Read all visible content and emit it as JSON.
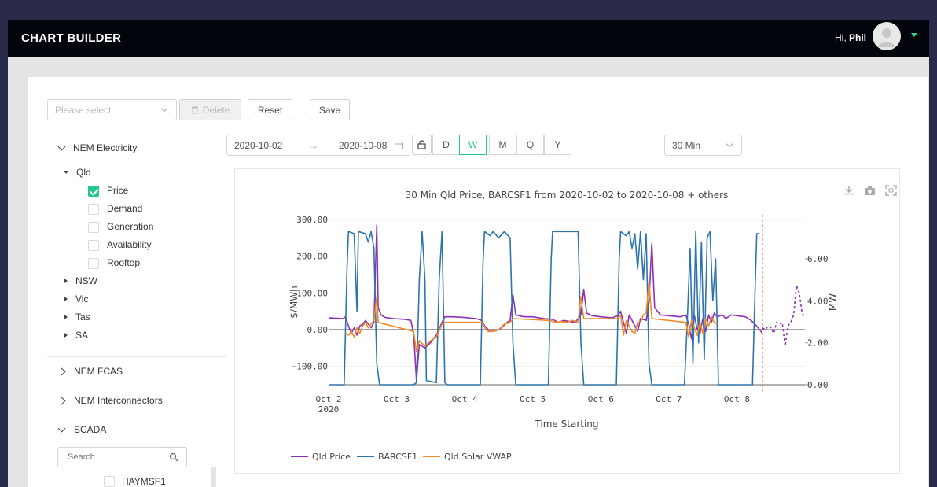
{
  "header": {
    "title": "CHART BUILDER",
    "greeting": "Hi,",
    "user": "Phil"
  },
  "toolbar": {
    "select_placeholder": "Please select",
    "delete_label": "Delete",
    "reset_label": "Reset",
    "save_label": "Save"
  },
  "range": {
    "start": "2020-10-02",
    "arrow": "→",
    "end": "2020-10-08"
  },
  "periods": [
    "D",
    "W",
    "M",
    "Q",
    "Y"
  ],
  "active_period": "W",
  "interval": "30 Min",
  "tree": {
    "nem_electricity": "NEM Electricity",
    "qld": "Qld",
    "qld_items": [
      "Price",
      "Demand",
      "Generation",
      "Availability",
      "Rooftop"
    ],
    "checked": "Price",
    "regions": [
      "NSW",
      "Vic",
      "Tas",
      "SA"
    ],
    "nem_fcas": "NEM FCAS",
    "nem_interconnectors": "NEM Interconnectors",
    "scada": "SCADA",
    "search_placeholder": "Search",
    "scada_item": "HAYMSF1"
  },
  "colors": {
    "accent": "#23c98a",
    "price": "#8e2fb5",
    "barcsf1": "#2d74ad",
    "solar": "#f08a24"
  },
  "chart_data": {
    "type": "line",
    "title": "30 Min Qld Price, BARCSF1 from 2020-10-02 to 2020-10-08 + others",
    "xlabel": "Time Starting",
    "ylabel": "$/MWh",
    "y2label": "MW",
    "x_ticks": [
      "Oct 2",
      "Oct 3",
      "Oct 4",
      "Oct 5",
      "Oct 6",
      "Oct 7",
      "Oct 8"
    ],
    "x_tick_year": "2020",
    "xlim": [
      "2020-10-02 00:00",
      "2020-10-09 00:00"
    ],
    "y_ticks": [
      "300.00",
      "200.00",
      "100.00",
      "0.00",
      "−100.00"
    ],
    "ylim": [
      -150,
      300
    ],
    "y2_ticks": [
      "6.00",
      "4.00",
      "2.00",
      "0.00"
    ],
    "y2lim": [
      0,
      7.5
    ],
    "cutoff": "2020-10-08 09:00",
    "series": [
      {
        "name": "Qld Price",
        "color": "#8e2fb5",
        "axis": "y",
        "points": [
          [
            "10-02 00:00",
            32
          ],
          [
            "10-02 03:00",
            31
          ],
          [
            "10-02 05:00",
            30
          ],
          [
            "10-02 06:00",
            35
          ],
          [
            "10-02 07:00",
            10
          ],
          [
            "10-02 08:00",
            -10
          ],
          [
            "10-02 09:00",
            5
          ],
          [
            "10-02 10:00",
            -15
          ],
          [
            "10-02 11:00",
            10
          ],
          [
            "10-02 12:00",
            15
          ],
          [
            "10-02 13:00",
            25
          ],
          [
            "10-02 15:00",
            5
          ],
          [
            "10-02 16:00",
            20
          ],
          [
            "10-02 17:00",
            285
          ],
          [
            "10-02 17:30",
            60
          ],
          [
            "10-02 18:30",
            40
          ],
          [
            "10-02 20:00",
            33
          ],
          [
            "10-02 23:00",
            30
          ],
          [
            "10-03 03:00",
            28
          ],
          [
            "10-03 05:00",
            25
          ],
          [
            "10-03 06:00",
            -10
          ],
          [
            "10-03 07:00",
            -140
          ],
          [
            "10-03 08:00",
            -40
          ],
          [
            "10-03 10:00",
            -50
          ],
          [
            "10-03 12:00",
            -35
          ],
          [
            "10-03 14:00",
            -15
          ],
          [
            "10-03 16:00",
            20
          ],
          [
            "10-03 17:00",
            35
          ],
          [
            "10-03 20:00",
            35
          ],
          [
            "10-04 00:00",
            33
          ],
          [
            "10-04 04:00",
            30
          ],
          [
            "10-04 06:00",
            25
          ],
          [
            "10-04 07:00",
            10
          ],
          [
            "10-04 09:00",
            -5
          ],
          [
            "10-04 11:00",
            -3
          ],
          [
            "10-04 13:00",
            5
          ],
          [
            "10-04 15:00",
            20
          ],
          [
            "10-04 16:00",
            25
          ],
          [
            "10-04 17:00",
            95
          ],
          [
            "10-04 18:00",
            40
          ],
          [
            "10-04 21:00",
            35
          ],
          [
            "10-05 00:00",
            35
          ],
          [
            "10-05 04:00",
            30
          ],
          [
            "10-05 07:00",
            28
          ],
          [
            "10-05 09:00",
            20
          ],
          [
            "10-05 11:00",
            25
          ],
          [
            "10-05 13:00",
            22
          ],
          [
            "10-05 15:00",
            20
          ],
          [
            "10-05 17:00",
            40
          ],
          [
            "10-05 18:00",
            110
          ],
          [
            "10-05 19:00",
            45
          ],
          [
            "10-05 21:00",
            38
          ],
          [
            "10-06 00:00",
            35
          ],
          [
            "10-06 04:00",
            32
          ],
          [
            "10-06 06:00",
            38
          ],
          [
            "10-06 07:00",
            50
          ],
          [
            "10-06 09:00",
            -10
          ],
          [
            "10-06 10:00",
            40
          ],
          [
            "10-06 11:00",
            25
          ],
          [
            "10-06 12:00",
            10
          ],
          [
            "10-06 13:00",
            -5
          ],
          [
            "10-06 14:00",
            30
          ],
          [
            "10-06 16:00",
            25
          ],
          [
            "10-06 17:00",
            75
          ],
          [
            "10-06 18:00",
            235
          ],
          [
            "10-06 19:00",
            60
          ],
          [
            "10-06 21:00",
            40
          ],
          [
            "10-07 00:00",
            38
          ],
          [
            "10-07 04:00",
            35
          ],
          [
            "10-07 06:00",
            40
          ],
          [
            "10-07 07:00",
            15
          ],
          [
            "10-07 08:00",
            -25
          ],
          [
            "10-07 09:00",
            40
          ],
          [
            "10-07 10:00",
            0
          ],
          [
            "10-07 11:00",
            -10
          ],
          [
            "10-07 12:00",
            30
          ],
          [
            "10-07 13:00",
            -5
          ],
          [
            "10-07 14:00",
            40
          ],
          [
            "10-07 15:00",
            20
          ],
          [
            "10-07 16:00",
            45
          ],
          [
            "10-07 17:00",
            35
          ],
          [
            "10-07 19:00",
            40
          ],
          [
            "10-07 20:00",
            30
          ],
          [
            "10-07 22:00",
            40
          ],
          [
            "10-08 00:00",
            38
          ],
          [
            "10-08 03:00",
            35
          ],
          [
            "10-08 05:00",
            25
          ],
          [
            "10-08 07:00",
            10
          ],
          [
            "10-08 09:00",
            -10
          ]
        ]
      },
      {
        "name": "BARCSF1",
        "color": "#2d74ad",
        "axis": "y2",
        "points": [
          [
            "10-02 00:00",
            0
          ],
          [
            "10-02 05:30",
            0
          ],
          [
            "10-02 06:30",
            5.5
          ],
          [
            "10-02 07:00",
            7.3
          ],
          [
            "10-02 09:00",
            7.2
          ],
          [
            "10-02 10:00",
            3.5
          ],
          [
            "10-02 10:30",
            7.3
          ],
          [
            "10-02 13:00",
            7.2
          ],
          [
            "10-02 14:00",
            6.8
          ],
          [
            "10-02 15:00",
            7.3
          ],
          [
            "10-02 16:00",
            6.5
          ],
          [
            "10-02 17:00",
            1
          ],
          [
            "10-02 18:00",
            0
          ],
          [
            "10-03 05:00",
            0
          ],
          [
            "10-03 06:00",
            0
          ],
          [
            "10-03 07:00",
            0.1
          ],
          [
            "10-03 08:00",
            5
          ],
          [
            "10-03 09:00",
            7.3
          ],
          [
            "10-03 10:00",
            5
          ],
          [
            "10-03 10:30",
            0.2
          ],
          [
            "10-03 14:00",
            0.1
          ],
          [
            "10-03 15:00",
            5
          ],
          [
            "10-03 16:00",
            7.3
          ],
          [
            "10-03 17:00",
            0.1
          ],
          [
            "10-03 18:00",
            0
          ],
          [
            "10-04 05:30",
            0
          ],
          [
            "10-04 06:30",
            6
          ],
          [
            "10-04 07:00",
            7.3
          ],
          [
            "10-04 09:00",
            7.1
          ],
          [
            "10-04 10:00",
            7.3
          ],
          [
            "10-04 12:00",
            7.0
          ],
          [
            "10-04 14:00",
            7.3
          ],
          [
            "10-04 16:00",
            7
          ],
          [
            "10-04 17:00",
            2
          ],
          [
            "10-04 18:00",
            0
          ],
          [
            "10-05 05:30",
            0
          ],
          [
            "10-05 06:30",
            6
          ],
          [
            "10-05 07:00",
            7.3
          ],
          [
            "10-05 16:00",
            7.3
          ],
          [
            "10-05 17:00",
            2
          ],
          [
            "10-05 18:00",
            0
          ],
          [
            "10-06 05:30",
            0
          ],
          [
            "10-06 06:30",
            6
          ],
          [
            "10-06 07:00",
            7.3
          ],
          [
            "10-06 09:00",
            7.1
          ],
          [
            "10-06 10:00",
            7.3
          ],
          [
            "10-06 11:00",
            6.5
          ],
          [
            "10-06 12:00",
            7.2
          ],
          [
            "10-06 13:00",
            5.5
          ],
          [
            "10-06 14:00",
            7.3
          ],
          [
            "10-06 15:00",
            5
          ],
          [
            "10-06 16:00",
            7.2
          ],
          [
            "10-06 17:00",
            1
          ],
          [
            "10-06 18:00",
            0
          ],
          [
            "10-07 05:30",
            0
          ],
          [
            "10-07 06:30",
            3
          ],
          [
            "10-07 07:30",
            6.5
          ],
          [
            "10-07 08:30",
            1
          ],
          [
            "10-07 09:30",
            7.3
          ],
          [
            "10-07 10:30",
            2
          ],
          [
            "10-07 11:30",
            6.8
          ],
          [
            "10-07 12:30",
            1.2
          ],
          [
            "10-07 13:30",
            7
          ],
          [
            "10-07 14:30",
            7.3
          ],
          [
            "10-07 15:30",
            4
          ],
          [
            "10-07 16:30",
            6
          ],
          [
            "10-07 17:30",
            0
          ],
          [
            "10-08 05:30",
            0
          ],
          [
            "10-08 06:30",
            5
          ],
          [
            "10-08 07:00",
            7.2
          ],
          [
            "10-08 08:00",
            7.2
          ]
        ]
      },
      {
        "name": "Qld Solar VWAP",
        "color": "#f08a24",
        "axis": "y",
        "points": [
          [
            "10-02 06:00",
            -10
          ],
          [
            "10-02 07:00",
            -15
          ],
          [
            "10-02 08:00",
            -5
          ],
          [
            "10-02 09:00",
            -20
          ],
          [
            "10-02 10:00",
            5
          ],
          [
            "10-02 11:00",
            -10
          ],
          [
            "10-02 12:00",
            10
          ],
          [
            "10-02 13:00",
            20
          ],
          [
            "10-02 14:00",
            5
          ],
          [
            "10-02 15:00",
            15
          ],
          [
            "10-02 16:00",
            25
          ],
          [
            "10-02 17:00",
            90
          ],
          [
            "10-02 17:30",
            20
          ],
          [
            "10-03 06:00",
            -5
          ],
          [
            "10-03 07:00",
            -60
          ],
          [
            "10-03 08:00",
            -30
          ],
          [
            "10-03 10:00",
            -45
          ],
          [
            "10-03 12:00",
            -30
          ],
          [
            "10-03 14:00",
            -20
          ],
          [
            "10-03 16:00",
            15
          ],
          [
            "10-03 17:00",
            20
          ],
          [
            "10-04 06:00",
            20
          ],
          [
            "10-04 08:00",
            -5
          ],
          [
            "10-04 10:00",
            -5
          ],
          [
            "10-04 12:00",
            0
          ],
          [
            "10-04 14:00",
            15
          ],
          [
            "10-04 16:00",
            20
          ],
          [
            "10-04 17:00",
            30
          ],
          [
            "10-05 06:00",
            25
          ],
          [
            "10-05 08:00",
            20
          ],
          [
            "10-05 10:00",
            22
          ],
          [
            "10-05 12:00",
            20
          ],
          [
            "10-05 14:00",
            25
          ],
          [
            "10-05 16:00",
            20
          ],
          [
            "10-05 17:00",
            90
          ],
          [
            "10-05 18:00",
            30
          ],
          [
            "10-06 06:00",
            30
          ],
          [
            "10-06 07:00",
            40
          ],
          [
            "10-06 08:00",
            -15
          ],
          [
            "10-06 09:00",
            25
          ],
          [
            "10-06 10:00",
            10
          ],
          [
            "10-06 11:00",
            -5
          ],
          [
            "10-06 12:00",
            -10
          ],
          [
            "10-06 13:00",
            20
          ],
          [
            "10-06 14:00",
            20
          ],
          [
            "10-06 15:00",
            40
          ],
          [
            "10-06 16:00",
            45
          ],
          [
            "10-06 17:00",
            130
          ],
          [
            "10-06 18:00",
            30
          ],
          [
            "10-07 06:00",
            20
          ],
          [
            "10-07 07:00",
            -20
          ],
          [
            "10-07 08:00",
            25
          ],
          [
            "10-07 09:00",
            5
          ],
          [
            "10-07 10:00",
            -15
          ],
          [
            "10-07 11:00",
            20
          ],
          [
            "10-07 12:00",
            -10
          ],
          [
            "10-07 13:00",
            30
          ],
          [
            "10-07 14:00",
            10
          ],
          [
            "10-07 15:00",
            35
          ],
          [
            "10-07 16:00",
            20
          ],
          [
            "10-07 17:00",
            15
          ]
        ]
      },
      {
        "name": "Qld Price forecast",
        "color": "#8e2fb5",
        "axis": "y",
        "dashed": true,
        "points": [
          [
            "10-08 09:00",
            5
          ],
          [
            "10-08 10:00",
            0
          ],
          [
            "10-08 11:00",
            10
          ],
          [
            "10-08 12:00",
            5
          ],
          [
            "10-08 13:00",
            -10
          ],
          [
            "10-08 14:00",
            20
          ],
          [
            "10-08 15:00",
            15
          ],
          [
            "10-08 16:00",
            20
          ],
          [
            "10-08 17:00",
            -45
          ],
          [
            "10-08 18:00",
            10
          ],
          [
            "10-08 19:00",
            20
          ],
          [
            "10-08 20:00",
            40
          ],
          [
            "10-08 21:00",
            120
          ],
          [
            "10-08 22:00",
            100
          ],
          [
            "10-08 23:00",
            45
          ],
          [
            "10-09 00:00",
            35
          ]
        ]
      }
    ],
    "legend": [
      "Qld Price",
      "BARCSF1",
      "Qld Solar VWAP"
    ],
    "legend_position": "bottom-left"
  }
}
